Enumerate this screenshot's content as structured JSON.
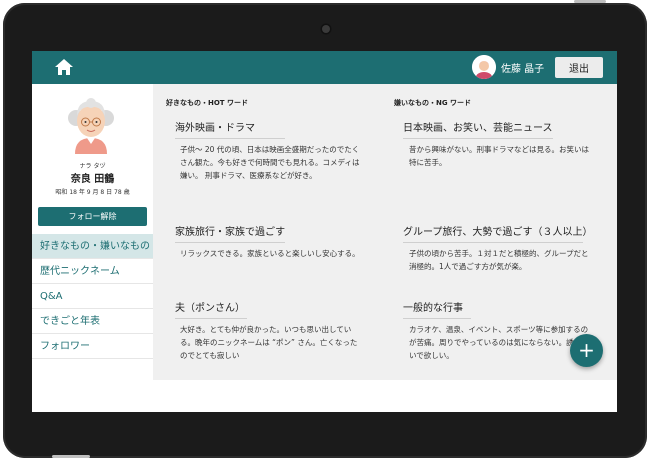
{
  "header": {
    "user_name": "佐藤 晶子",
    "logout_label": "退出"
  },
  "profile": {
    "kana": "ナラ タヅ",
    "name": "奈良 田鶴",
    "birth": "昭和 18 年 9 月 8 日 78 歳",
    "follow_label": "フォロー解除"
  },
  "sidebar": {
    "items": [
      {
        "label": "好きなもの・嫌いなもの",
        "active": true
      },
      {
        "label": "歴代ニックネーム"
      },
      {
        "label": "Q&A"
      },
      {
        "label": "できごと年表"
      },
      {
        "label": "フォロワー"
      }
    ]
  },
  "likes": {
    "heading": "好きなもの・HOT ワード",
    "items": [
      {
        "title": "海外映画・ドラマ",
        "text": "子供～ 20 代の頃、日本は映画全盛期だったのでたくさん観た。今も好きで何時間でも見れる。コメディは嫌い。 刑事ドラマ、医療系などが好き。"
      },
      {
        "title": "家族旅行・家族で過ごす",
        "text": "リラックスできる。家族といると楽しいし安心する。"
      },
      {
        "title": "夫（ポンさん）",
        "text": "大好き。とても仲が良かった。いつも思い出している。晩年のニックネームは “ポン” さん。亡くなったのでとても寂しい"
      }
    ]
  },
  "dislikes": {
    "heading": "嫌いなもの・NG ワード",
    "items": [
      {
        "title": "日本映画、お笑い、芸能ニュース",
        "text": "昔から興味がない。刑事ドラマなどは見る。お笑いは特に苦手。"
      },
      {
        "title": "グループ旅行、大勢で過ごす（３人以上）",
        "text": "子供の頃から苦手。１対１だと積極的、グループだと消極的。1人で過ごす方が気が楽。"
      },
      {
        "title": "一般的な行事",
        "text": "カラオケ、温泉、イベント、スポーツ等に参加するのが苦痛。周りでやっているのは気にならない。誘わないで欲しい。"
      }
    ]
  },
  "fab_label": "+",
  "colors": {
    "primary": "#1d6e72",
    "content_bg": "#f0f0f0",
    "nav_active": "#d4e6e7"
  }
}
